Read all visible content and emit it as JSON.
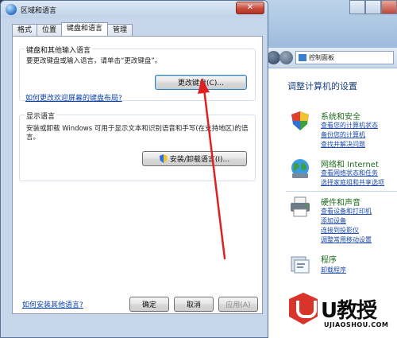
{
  "dialog": {
    "title": "区域和语言",
    "close_label": "✕",
    "tabs": [
      {
        "label": "格式"
      },
      {
        "label": "位置"
      },
      {
        "label": "键盘和语言"
      },
      {
        "label": "管理"
      }
    ],
    "keyboard_group": {
      "label": "键盘和其他输入语言",
      "text": "要更改键盘或输入语言，请单击“更改键盘”。",
      "change_keyboard_button": "更改键盘(C)...",
      "welcome_link": "如何更改欢迎屏幕的键盘布局?"
    },
    "display_group": {
      "label": "显示语言",
      "text_line1": "安装或卸载 Windows 可用于显示文本和识别语音和手写(在支持地区)的语",
      "text_line2": "言。",
      "install_button": "安装/卸载语言(I)..."
    },
    "install_more_link": "如何安装其他语言?",
    "footer": {
      "ok": "确定",
      "cancel": "取消",
      "apply": "应用(A)"
    }
  },
  "control_panel": {
    "address": "控制面板",
    "heading": "调整计算机的设置",
    "categories": [
      {
        "title": "系统和安全",
        "links": [
          "查看您的计算机状态",
          "备份您的计算机",
          "查找并解决问题"
        ]
      },
      {
        "title": "网络和 Internet",
        "links": [
          "查看网络状态和任务",
          "选择家庭组和共享选项"
        ]
      },
      {
        "title": "硬件和声音",
        "links": [
          "查看设备和打印机",
          "添加设备",
          "连接到投影仪",
          "调整常用移动设置"
        ]
      },
      {
        "title": "程序",
        "links": [
          "卸载程序"
        ]
      }
    ]
  },
  "watermark": {
    "brand": "U教授",
    "domain": "UJIAOSHOU.COM"
  },
  "colors": {
    "link": "#0b3fa8",
    "category_title": "#1c6c1c",
    "annotation": "#e02020"
  }
}
